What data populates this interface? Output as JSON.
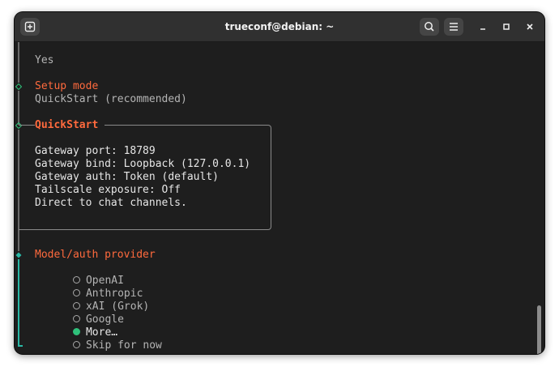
{
  "window": {
    "title": "trueconf@debian: ~",
    "new_tab_icon": "new-tab-icon",
    "search_icon": "search-icon",
    "menu_icon": "hamburger-menu-icon",
    "minimize_icon": "minimize-icon",
    "maximize_icon": "maximize-icon",
    "close_icon": "close-icon"
  },
  "terminal": {
    "prev_answer": "Yes",
    "setup_mode": {
      "label": "Setup mode",
      "value": "QuickStart (recommended)"
    },
    "quickstart": {
      "title": "QuickStart",
      "lines": [
        "Gateway port: 18789",
        "Gateway bind: Loopback (127.0.0.1)",
        "Gateway auth: Token (default)",
        "Tailscale exposure: Off",
        "Direct to chat channels."
      ]
    },
    "provider": {
      "label": "Model/auth provider",
      "options": [
        {
          "label": "OpenAI",
          "selected": false
        },
        {
          "label": "Anthropic",
          "selected": false
        },
        {
          "label": "xAI (Grok)",
          "selected": false
        },
        {
          "label": "Google",
          "selected": false
        },
        {
          "label": "More…",
          "selected": true
        },
        {
          "label": "Skip for now",
          "selected": false
        }
      ]
    }
  },
  "colors": {
    "background": "#1e1e1e",
    "titlebar": "#303030",
    "heading": "#ff6a3d",
    "active_rail": "#2ab8a6",
    "selected_radio": "#2fc07a"
  }
}
